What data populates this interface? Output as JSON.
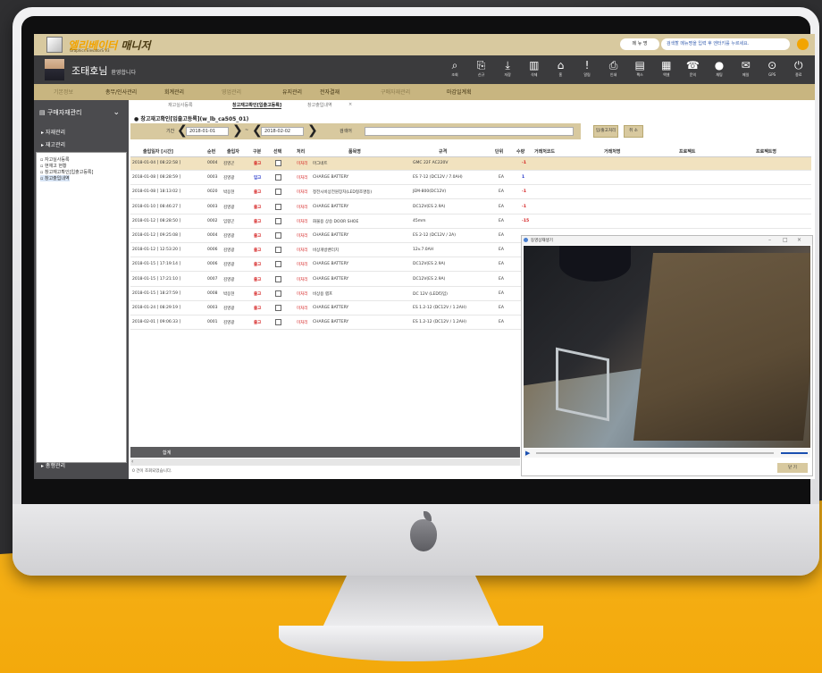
{
  "app": {
    "title_main": "엘리베이터",
    "title_tail": " 매니저",
    "subtitle": "Graphics ElevatorS V3",
    "menu_label": "메 뉴 명",
    "menu_hint": "검색할 메뉴명을 입력 후 엔터키를 누르세요."
  },
  "user": {
    "name": "조태호님",
    "greeting": "환영합니다"
  },
  "toolbar": [
    {
      "label": "조회",
      "icon": "search-icon",
      "glyph": "⌕"
    },
    {
      "label": "신규",
      "icon": "new-icon",
      "glyph": "⎘"
    },
    {
      "label": "저장",
      "icon": "save-icon",
      "glyph": "⤓"
    },
    {
      "label": "삭제",
      "icon": "trash-icon",
      "glyph": "▥"
    },
    {
      "label": "홈",
      "icon": "home-icon",
      "glyph": "⌂"
    },
    {
      "label": "알림",
      "icon": "alert-icon",
      "glyph": "!"
    },
    {
      "label": "인쇄",
      "icon": "print-icon",
      "glyph": "⎙"
    },
    {
      "label": "팩스",
      "icon": "fax-icon",
      "glyph": "▤"
    },
    {
      "label": "엑셀",
      "icon": "excel-icon",
      "glyph": "▦"
    },
    {
      "label": "문의",
      "icon": "phone-icon",
      "glyph": "☎"
    },
    {
      "label": "채팅",
      "icon": "chat-icon",
      "glyph": "●"
    },
    {
      "label": "메일",
      "icon": "mail-icon",
      "glyph": "✉"
    },
    {
      "label": "GPS",
      "icon": "location-icon",
      "glyph": "⊙"
    },
    {
      "label": "종료",
      "icon": "power-icon",
      "glyph": "⏻"
    }
  ],
  "nav": [
    {
      "label": "기본정보",
      "dim": true
    },
    {
      "label": "총무/인사관리",
      "dim": false
    },
    {
      "label": "회계관리",
      "dim": false
    },
    {
      "label": "영업관리",
      "dim": true
    },
    {
      "label": "유지관리",
      "dim": false
    },
    {
      "label": "전자결재",
      "dim": false
    },
    {
      "label": "구매자재관리",
      "dim": true
    },
    {
      "label": "마감일계획",
      "dim": false
    }
  ],
  "sidebar": {
    "header": "구매자재관리",
    "sections": [
      "자재관리",
      "재고관리"
    ],
    "tree": [
      "자고실사등록",
      "현재고 현황",
      "창고재고확인[입출고등록]",
      "창고출입내역"
    ],
    "bottom": "총행관리"
  },
  "tabs": [
    "재고실사등록",
    "창고재고확인[입출고등록]",
    "창고출입내역"
  ],
  "page": {
    "title": "창고재고확인[입출고등록](w_lb_ca505_01)"
  },
  "filter": {
    "period_label": "기간",
    "date_from": "2018-01-01",
    "date_to": "2018-02-02",
    "search_label": "검색어",
    "btn_inout": "입/출고처리",
    "btn_cancel": "취 소"
  },
  "grid": {
    "headers": [
      "출입일자 [시간]",
      "순번",
      "출입자",
      "구분",
      "선택",
      "처리",
      "품목명",
      "규격",
      "단위",
      "수량",
      "거래처코드",
      "거래처명",
      "프로젝트",
      "프로젝트명"
    ],
    "rows": [
      {
        "date": "2018-01-04 [ 08:22:58 ]",
        "seq": "0004",
        "user": "김영곤",
        "type": "출고",
        "action": "미처리",
        "item": "마그네트",
        "spec": "GMC 22F AC220V",
        "unit": "",
        "qty": "-1"
      },
      {
        "date": "2018-01-08 [ 08:28:59 ]",
        "seq": "0003",
        "user": "김영광",
        "type": "입고",
        "action": "미처리",
        "item": "CHARGE BATTERY",
        "spec": "ES 7-12  (DC12V / 7.0AH)",
        "unit": "EA",
        "qty": "1"
      },
      {
        "date": "2018-01-08 [ 18:13:02 ]",
        "seq": "0020",
        "user": "박응현",
        "type": "출고",
        "action": "미처리",
        "item": "정전시비상전원장치(LED형조명등)",
        "spec": "JEM-800(DC12V)",
        "unit": "EA",
        "qty": "-1"
      },
      {
        "date": "2018-01-10 [ 08:46:27 ]",
        "seq": "0003",
        "user": "김영광",
        "type": "출고",
        "action": "미처리",
        "item": "CHARGE BATTERY",
        "spec": "DC12V(ES 2.9A)",
        "unit": "EA",
        "qty": "-1"
      },
      {
        "date": "2018-01-12 [ 08:28:50 ]",
        "seq": "0002",
        "user": "임향곤",
        "type": "출고",
        "action": "미처리",
        "item": "화물용 상승 DOOR SHOE",
        "spec": "45mm",
        "unit": "EA",
        "qty": "-15"
      },
      {
        "date": "2018-01-12 [ 09:25:08 ]",
        "seq": "0004",
        "user": "김영광",
        "type": "출고",
        "action": "미처리",
        "item": "CHARGE BATTERY",
        "spec": "ES 2-12  (DC12V / 2A)",
        "unit": "EA",
        "qty": ""
      },
      {
        "date": "2018-01-12 [ 12:53:20 ]",
        "seq": "0006",
        "user": "김영광",
        "type": "출고",
        "action": "미처리",
        "item": "비상개방밴더치",
        "spec": "12v.7.0AH",
        "unit": "EA",
        "qty": ""
      },
      {
        "date": "2018-01-15 [ 17:19:14 ]",
        "seq": "0006",
        "user": "김영광",
        "type": "출고",
        "action": "미처리",
        "item": "CHARGE BATTERY",
        "spec": "DC12V(ES 2.9A)",
        "unit": "EA",
        "qty": ""
      },
      {
        "date": "2018-01-15 [ 17:21:10 ]",
        "seq": "0007",
        "user": "김영광",
        "type": "출고",
        "action": "미처리",
        "item": "CHARGE BATTERY",
        "spec": "DC12V(ES 2.9A)",
        "unit": "EA",
        "qty": ""
      },
      {
        "date": "2018-01-15 [ 18:27:59 ]",
        "seq": "0008",
        "user": "박응현",
        "type": "출고",
        "action": "미처리",
        "item": "비상용 램프",
        "spec": "DC 12V (LED타입)",
        "unit": "EA",
        "qty": ""
      },
      {
        "date": "2018-01-24 [ 08:29:19 ]",
        "seq": "0003",
        "user": "김영광",
        "type": "출고",
        "action": "미처리",
        "item": "CHARGE BATTERY",
        "spec": "ES 1.2-12  (DC12V / 1.2AH)",
        "unit": "EA",
        "qty": ""
      },
      {
        "date": "2018-02-01 [ 09:06:33 ]",
        "seq": "0001",
        "user": "김영광",
        "type": "출고",
        "action": "미처리",
        "item": "CHARGE BATTERY",
        "spec": "ES 1.2-12  (DC12V / 1.2AH)",
        "unit": "EA",
        "qty": ""
      }
    ],
    "footer_label": "합계",
    "status": "0 건이 조회되었습니다."
  },
  "video_window": {
    "title": "동영상재생기",
    "close_label": "닫 기"
  },
  "colors": {
    "topbar": "#d8c99f",
    "userbar": "#3b3b3d",
    "accent": "#f2a400",
    "out": "#d41c1c",
    "in": "#2234c8",
    "selected_row": "#f1e2bf",
    "background_lower": "#f6b21a"
  }
}
